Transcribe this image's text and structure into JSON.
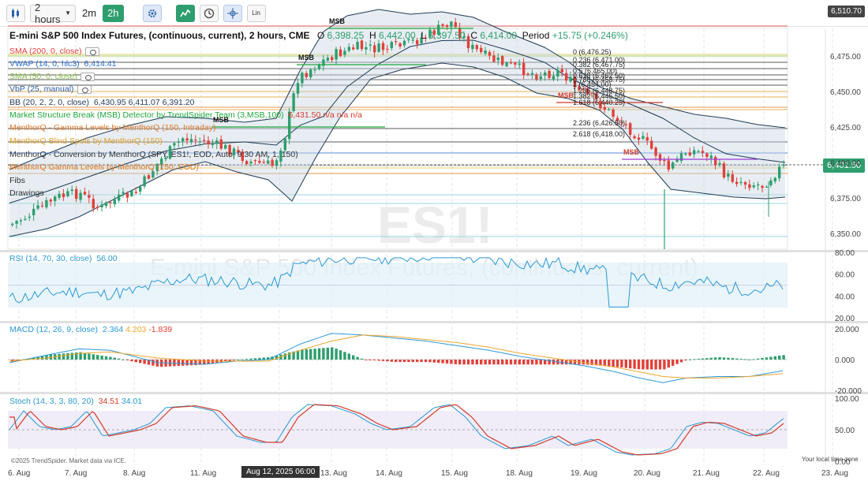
{
  "toolbar": {
    "timeframe": "2 hours",
    "tf_short": "2m",
    "tf_active": "2h",
    "lin_label": "Lin"
  },
  "header": {
    "title": "E-mini S&P 500 Index Futures, (continuous, current), 2 hours, CME",
    "o_label": "O",
    "o_val": "6,398.25",
    "h_label": "H",
    "h_val": "6,442.00",
    "l_label": "L",
    "l_val": "6,397.50",
    "c_label": "C",
    "c_val": "6,414.00",
    "period_label": "Period",
    "change": "+15.75 (+0.246%)"
  },
  "legend": {
    "sma200": "SMA (200, 0, close)",
    "vwap": "VWAP (14, 0, hlc3)",
    "vwap_val": "6,414.41",
    "sma50": "SMA (50, 0, close)",
    "vbp": "VbP (25, manual)",
    "bb": "BB (20, 2, 2, 0, close)",
    "bb_vals": "6,430.95  6,411.07  6,391.20",
    "msb": "Market Structure Break (MSB) Detector by TrendSpider Team (3,MSB,100)",
    "msb_vals": "6,431.50  n/a  n/a  n/a",
    "gamma": "MenthorQ - Gamma Levels by MenthorQ (150, Intraday)",
    "blind": "MenthorQ Blind Spots by MenthorQ (150)",
    "conv": "MenthorQ - Conversion by MenthorQ (SPY, ES1!, EOD, Auto, 9:30 AM, 1, 150)",
    "gamma_eod": "MenthorQ Gamma Levels by MenthorQ (150, EOD)",
    "fibs": "Fibs",
    "drawings": "Drawings"
  },
  "watermark": {
    "symbol": "ES1!",
    "name": "E-mini S&P 500 Index Futures, (continuous, current)"
  },
  "fib_labels": [
    "0 (6,476.25)",
    "0.236 (6,471.00)",
    "0.382 (6,467.75)",
    "0.5 (6,465.00)",
    "0.618 (6,462.50)",
    "0.786 (6,458.75)",
    "1 (6,454.00)",
    "1.236 (6,448.75)",
    "1.382 (6,445.50)",
    "1.618 (6,440.25)",
    "2.236 (6,426.50)",
    "2.618 (6,418.00)"
  ],
  "msb_labels": [
    "MSB",
    "MSB",
    "MSB",
    "MSB",
    "MSB"
  ],
  "price_axis": [
    "6,475.00",
    "6,450.00",
    "6,425.00",
    "6,400.00",
    "6,375.00",
    "6,350.00"
  ],
  "current_price": "6,401.50",
  "top_price": "6,510.70",
  "rsi": {
    "label": "RSI (14, 70, 30, close)",
    "value": "56.00",
    "axis": [
      "80.00",
      "60.00",
      "40.00",
      "20.00"
    ]
  },
  "macd": {
    "label": "MACD (12, 26, 9, close)",
    "v1": "2.364",
    "v2": "4.203",
    "v3": "-1.839",
    "axis": [
      "20.000",
      "0.000",
      "-20.000"
    ]
  },
  "stoch": {
    "label": "Stoch (14, 3, 3, 80, 20)",
    "v1": "34.51",
    "v2": "34.01",
    "axis": [
      "100.00",
      "50.00",
      "0.00"
    ]
  },
  "dates": [
    "6. Aug",
    "7. Aug",
    "8. Aug",
    "11. Aug",
    "Aug 12, 2025 06:00",
    "13. Aug",
    "14. Aug",
    "15. Aug",
    "18. Aug",
    "19. Aug",
    "20. Aug",
    "21. Aug",
    "22. Aug",
    "23. Aug"
  ],
  "footer": {
    "credit": "©2025 TrendSpider. Market data via ICE.",
    "local_time": "Your local time zone"
  },
  "colors": {
    "up": "#2e9e6e",
    "down": "#e0413a",
    "bb": "#1f3b57",
    "rsi": "#2a98d6",
    "macd_sig": "#f0a52a",
    "stoch_k": "#2a98d6",
    "stoch_d": "#d43b2a"
  }
}
